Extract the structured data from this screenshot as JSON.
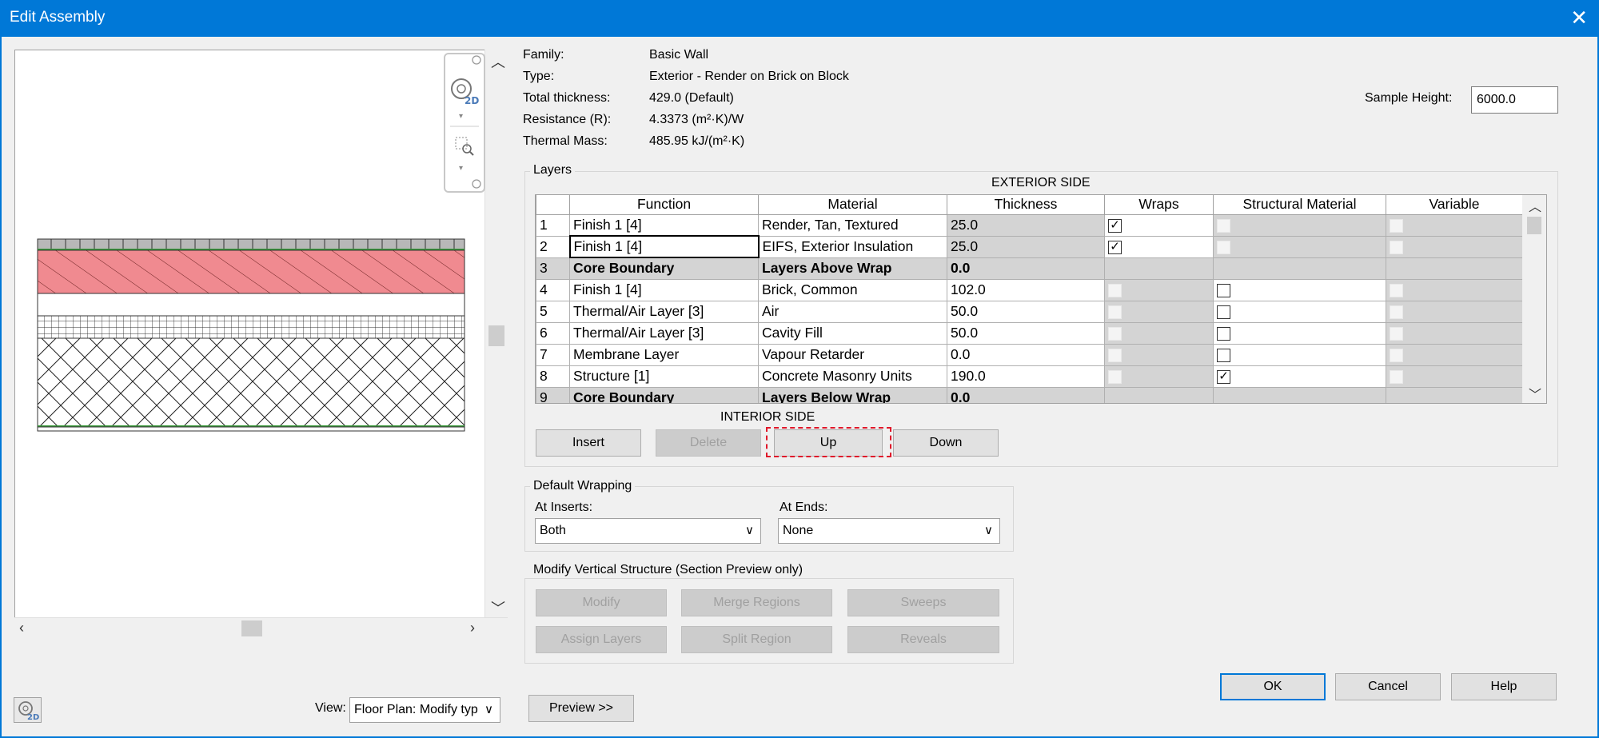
{
  "window": {
    "title": "Edit Assembly",
    "close_glyph": "✕"
  },
  "info": {
    "family_label": "Family:",
    "family": "Basic Wall",
    "type_label": "Type:",
    "type": "Exterior - Render on Brick on Block",
    "thickness_label": "Total thickness:",
    "thickness": "429.0 (Default)",
    "resistance_label": "Resistance (R):",
    "resistance": "4.3373 (m²·K)/W",
    "mass_label": "Thermal Mass:",
    "mass": "485.95 kJ/(m²·K)"
  },
  "sample_height": {
    "label": "Sample Height:",
    "value": "6000.0"
  },
  "layers": {
    "group_title": "Layers",
    "exterior_label": "EXTERIOR SIDE",
    "interior_label": "INTERIOR SIDE",
    "columns": [
      "",
      "Function",
      "Material",
      "Thickness",
      "Wraps",
      "Structural Material",
      "Variable"
    ],
    "rows": [
      {
        "num": "1",
        "function": "Finish 1 [4]",
        "material": "Render, Tan, Textured",
        "thickness": "25.0",
        "wraps": true,
        "structural": false,
        "variable": false
      },
      {
        "num": "2",
        "function": "Finish 1 [4]",
        "material": "EIFS, Exterior Insulation",
        "thickness": "25.0",
        "wraps": true,
        "structural": false,
        "variable": false
      },
      {
        "num": "3",
        "function": "Core Boundary",
        "material": "Layers Above Wrap",
        "thickness": "0.0"
      },
      {
        "num": "4",
        "function": "Finish 1 [4]",
        "material": "Brick, Common",
        "thickness": "102.0",
        "wraps": false,
        "structural": false,
        "variable": false
      },
      {
        "num": "5",
        "function": "Thermal/Air Layer [3]",
        "material": "Air",
        "thickness": "50.0",
        "wraps": false,
        "structural": false,
        "variable": false
      },
      {
        "num": "6",
        "function": "Thermal/Air Layer [3]",
        "material": "Cavity Fill",
        "thickness": "50.0",
        "wraps": false,
        "structural": false,
        "variable": false
      },
      {
        "num": "7",
        "function": "Membrane Layer",
        "material": "Vapour Retarder",
        "thickness": "0.0",
        "wraps": false,
        "structural": false,
        "variable": false
      },
      {
        "num": "8",
        "function": "Structure [1]",
        "material": "Concrete Masonry Units",
        "thickness": "190.0",
        "wraps": false,
        "structural": true,
        "variable": false
      },
      {
        "num": "9",
        "function": "Core Boundary",
        "material": "Layers Below Wrap",
        "thickness": "0.0"
      }
    ],
    "buttons": {
      "insert": "Insert",
      "delete": "Delete",
      "up": "Up",
      "down": "Down"
    }
  },
  "wrapping": {
    "group_title": "Default Wrapping",
    "inserts_label": "At Inserts:",
    "inserts_value": "Both",
    "ends_label": "At Ends:",
    "ends_value": "None"
  },
  "vertical": {
    "group_title": "Modify Vertical Structure (Section Preview only)",
    "buttons": [
      "Modify",
      "Merge Regions",
      "Sweeps",
      "Assign Layers",
      "Split Region",
      "Reveals"
    ]
  },
  "bottom": {
    "view_label": "View:",
    "view_value": "Floor Plan: Modify typ",
    "preview": "Preview >>",
    "ok": "OK",
    "cancel": "Cancel",
    "help": "Help"
  },
  "colors": {
    "accent": "#0078d7",
    "highlight": "#e0182a",
    "render": "#f0868c"
  }
}
